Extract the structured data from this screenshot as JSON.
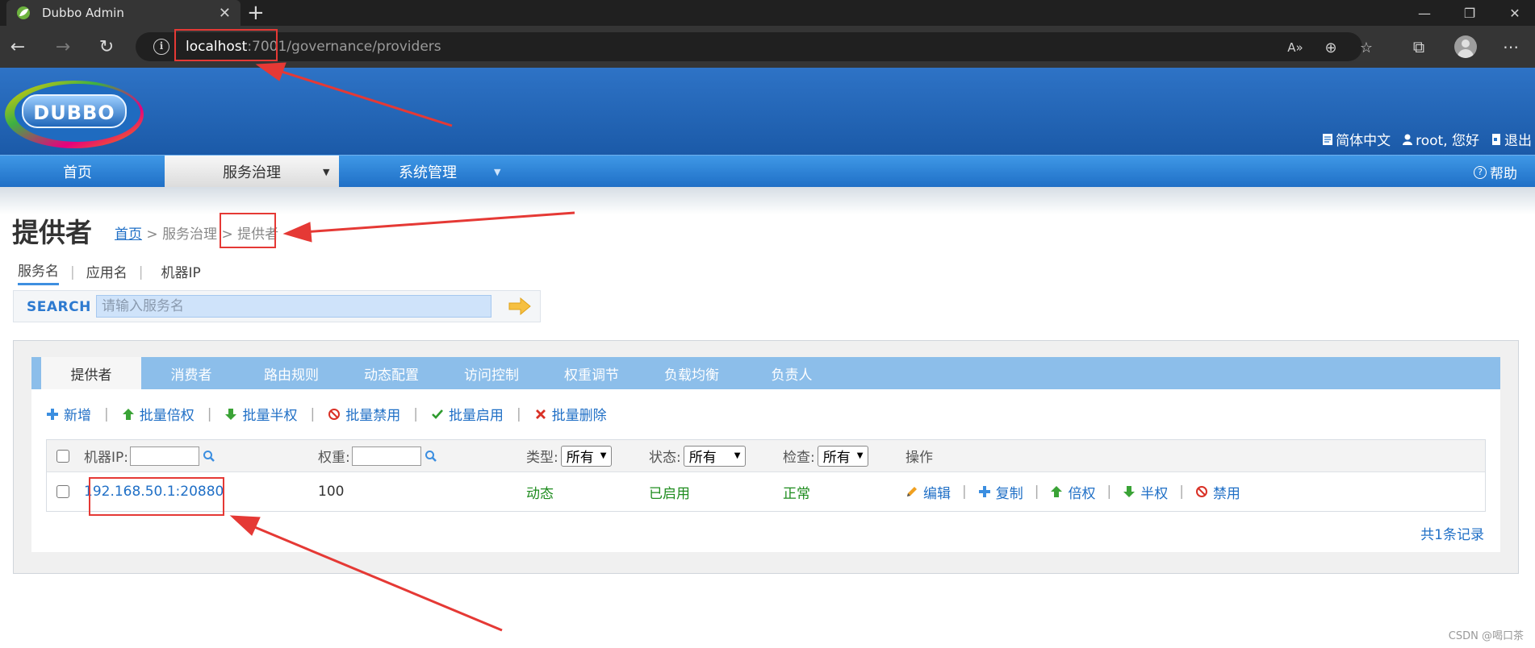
{
  "browser": {
    "tab_title": "Dubbo Admin",
    "url_host": "localhost",
    "url_rest": ":7001/governance/providers"
  },
  "header": {
    "logo_text": "DUBBO",
    "lang": "简体中文",
    "user": "root, 您好",
    "logout": "退出"
  },
  "nav": {
    "items": [
      {
        "label": "首页"
      },
      {
        "label": "服务治理"
      },
      {
        "label": "系统管理"
      }
    ],
    "help": "帮助"
  },
  "page": {
    "title": "提供者",
    "breadcrumb": {
      "home": "首页",
      "sep1": " > ",
      "section": "服务治理",
      "sep2": " > ",
      "current": "提供者"
    }
  },
  "search": {
    "tabs": [
      {
        "label": "服务名"
      },
      {
        "label": "应用名"
      },
      {
        "label": "机器IP"
      }
    ],
    "label": "SEARCH",
    "placeholder": "请输入服务名"
  },
  "panel_tabs": [
    {
      "label": "提供者"
    },
    {
      "label": "消费者"
    },
    {
      "label": "路由规则"
    },
    {
      "label": "动态配置"
    },
    {
      "label": "访问控制"
    },
    {
      "label": "权重调节"
    },
    {
      "label": "负载均衡"
    },
    {
      "label": "负责人"
    }
  ],
  "toolbar": {
    "add": "新增",
    "batch_double": "批量倍权",
    "batch_half": "批量半权",
    "batch_disable": "批量禁用",
    "batch_enable": "批量启用",
    "batch_delete": "批量删除"
  },
  "grid": {
    "headers": {
      "ip": "机器IP:",
      "weight": "权重:",
      "type": "类型:",
      "status": "状态:",
      "check": "检查:",
      "ops": "操作"
    },
    "filters": {
      "type": "所有",
      "status": "所有",
      "check": "所有"
    },
    "rows": [
      {
        "ip": "192.168.50.1:20880",
        "weight": "100",
        "type": "动态",
        "status": "已启用",
        "check": "正常",
        "ops": {
          "edit": "编辑",
          "copy": "复制",
          "double": "倍权",
          "half": "半权",
          "disable": "禁用"
        }
      }
    ],
    "total": "共1条记录"
  },
  "watermark": "CSDN @喝口茶",
  "colors": {
    "header_blue": "#1f6fc6",
    "status_green": "#1e8c1e",
    "annotation_red": "#e53935"
  }
}
